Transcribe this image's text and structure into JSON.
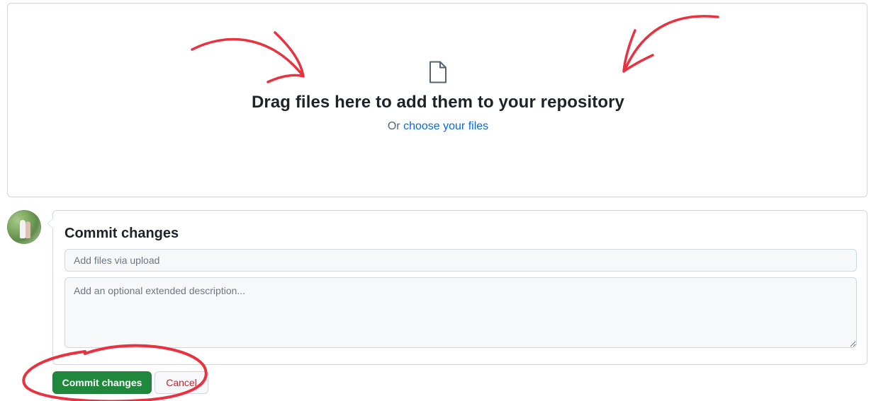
{
  "dropzone": {
    "title": "Drag files here to add them to your repository",
    "or_text": "Or ",
    "choose_link": "choose your files",
    "icon": "file-icon"
  },
  "commit": {
    "heading": "Commit changes",
    "summary_placeholder": "Add files via upload",
    "description_placeholder": "Add an optional extended description...",
    "commit_button": "Commit changes",
    "cancel_button": "Cancel"
  },
  "colors": {
    "primary_button": "#1f883d",
    "link": "#0969da",
    "cancel_text": "#cf222e",
    "annotation": "#e8323f"
  }
}
